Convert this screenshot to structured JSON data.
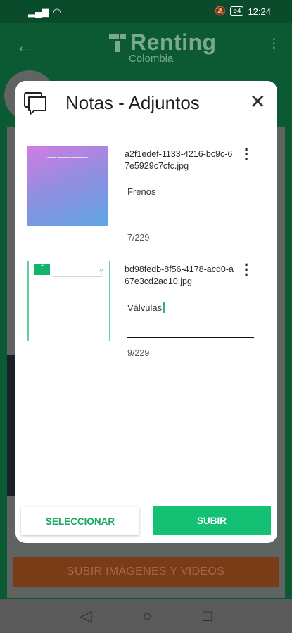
{
  "status_bar": {
    "time": "12:24",
    "battery": "54"
  },
  "app_bar": {
    "logo_title": "Renting",
    "logo_subtitle": "Colombia"
  },
  "background": {
    "upload_media_button": "SUBIR IMÁGENES Y VIDEOS"
  },
  "modal": {
    "title": "Notas - Adjuntos",
    "attachments": [
      {
        "file_name": "a2f1edef-1133-4216-bc9c-67e5929c7cfc.jpg",
        "note": "Frenos",
        "counter": "7/229"
      },
      {
        "file_name": "bd98fedb-8f56-4178-acd0-a67e3cd2ad10.jpg",
        "note": "Válvulas",
        "counter": "9/229"
      }
    ],
    "select_button": "SELECCIONAR",
    "upload_button": "SUBIR"
  },
  "colors": {
    "primary_green": "#14c174",
    "dark_green": "#0c5a33",
    "accent_orange": "#7a3b17"
  }
}
